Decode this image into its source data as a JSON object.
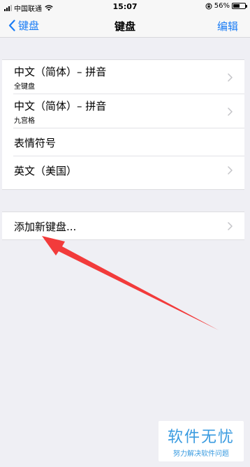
{
  "status_bar": {
    "carrier": "中国联通",
    "time": "15:07",
    "battery_percent": "56%",
    "battery_level": 0.56
  },
  "nav": {
    "back_label": "键盘",
    "title": "键盘",
    "edit_label": "编辑",
    "accent_color": "#1a7cf5"
  },
  "keyboards": [
    {
      "title": "中文（简体）– 拼音",
      "subtitle": "全键盘"
    },
    {
      "title": "中文（简体）– 拼音",
      "subtitle": "九宫格"
    },
    {
      "title": "表情符号"
    },
    {
      "title": "英文（美国）"
    }
  ],
  "add_keyboard_label": "添加新键盘...",
  "annotation": {
    "arrow_color": "#f23b3b"
  },
  "watermark": {
    "title": "软件无忧",
    "subtitle": "努力解决软件问题"
  }
}
